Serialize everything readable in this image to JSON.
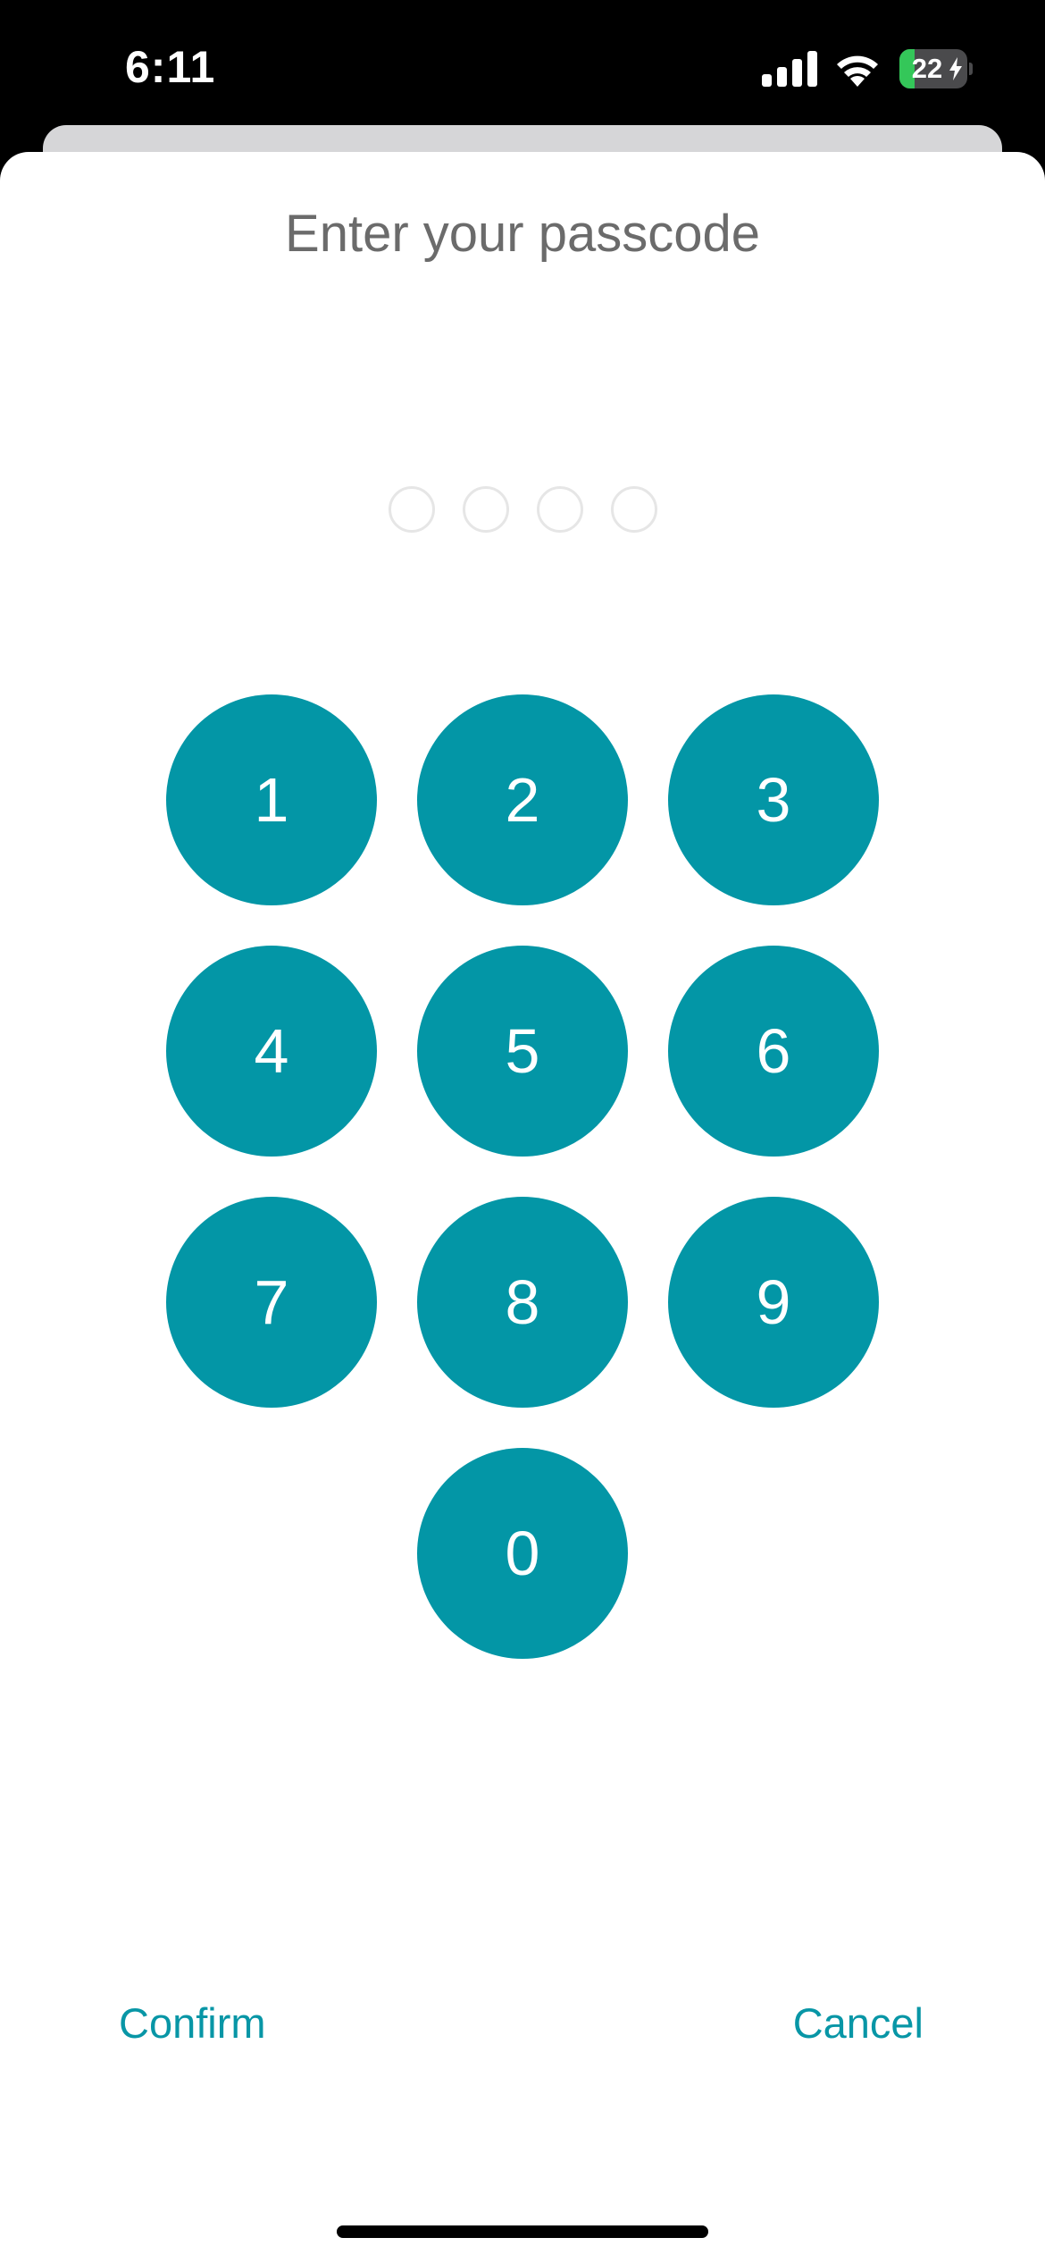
{
  "status_bar": {
    "time": "6:11",
    "battery_level": "22",
    "battery_fraction": 0.22,
    "icons": [
      "cellular-signal-icon",
      "wifi-icon",
      "battery-charging-icon"
    ]
  },
  "passcode": {
    "title": "Enter your passcode",
    "digit_count": 4,
    "entered_count": 0
  },
  "keypad": {
    "keys": [
      "1",
      "2",
      "3",
      "4",
      "5",
      "6",
      "7",
      "8",
      "9",
      "0"
    ]
  },
  "actions": {
    "confirm_label": "Confirm",
    "cancel_label": "Cancel"
  },
  "colors": {
    "accent": "#0396a6",
    "title_text": "#6b6b6b",
    "dot_border": "#e6e6e6",
    "battery_green": "#34c759"
  }
}
